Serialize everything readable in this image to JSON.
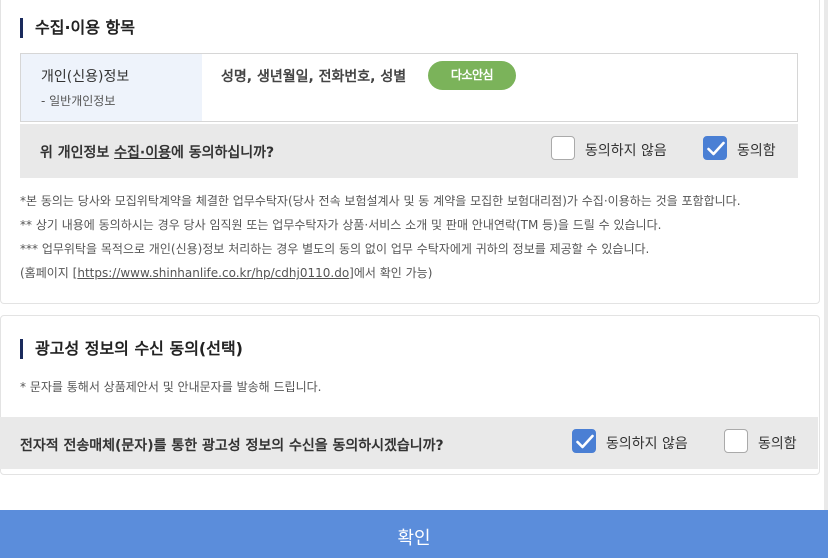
{
  "collection": {
    "title": "수집·이용 항목",
    "label": "개인(신용)정보",
    "sublabel": "- 일반개인정보",
    "items": "성명, 생년월일, 전화번호, 성별",
    "badge": "다소안심",
    "question_pre": "위 개인정보 ",
    "question_link": "수집·이용",
    "question_post": "에 동의하십니까?",
    "option_disagree": "동의하지 않음",
    "option_agree": "동의함",
    "disagree_checked": false,
    "agree_checked": true,
    "notes": [
      "*본 동의는 당사와 모집위탁계약을 체결한 업무수탁자(당사 전속 보험설계사 및 동 계약을 모집한 보험대리점)가 수집·이용하는 것을 포함합니다.",
      "** 상기 내용에 동의하시는 경우 당사 임직원 또는 업무수탁자가 상품·서비스 소개 및 판매 안내연락(TM 등)을 드릴 수 있습니다.",
      "*** 업무위탁을 목적으로 개인(신용)정보 처리하는 경우 별도의 동의 없이 업무 수탁자에게 귀하의 정보를 제공할 수 있습니다."
    ],
    "homepage_pre": "(홈페이지 [",
    "homepage_link": "https://www.shinhanlife.co.kr/hp/cdhj0110.do",
    "homepage_post": "]에서 확인 가능)"
  },
  "marketing": {
    "title": "광고성 정보의 수신 동의(선택)",
    "note": "* 문자를 통해서 상품제안서 및 안내문자를 발송해 드립니다.",
    "question": "전자적 전송매체(문자)를 통한 광고성 정보의 수신을 동의하시겠습니까?",
    "option_disagree": "동의하지 않음",
    "option_agree": "동의함",
    "disagree_checked": true,
    "agree_checked": false
  },
  "footer": {
    "confirm_label": "확인"
  },
  "colors": {
    "accent": "#4a7fd4",
    "confirm_bar": "#5b8ddb",
    "badge": "#7bb35a",
    "title_bar": "#1a2a5c"
  }
}
